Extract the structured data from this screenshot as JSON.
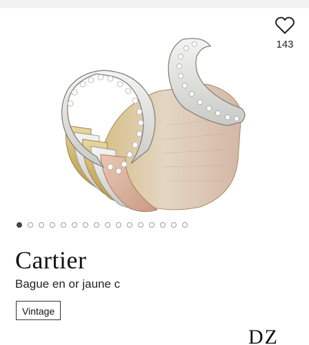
{
  "product": {
    "brand": "Cartier",
    "subtitle": "Bague en or jaune c",
    "badge": "Vintage",
    "favorites_count": "143"
  },
  "gallery": {
    "total_images": 16,
    "active_index": 0
  },
  "seller": {
    "logo_text": "DZ"
  },
  "icons": {
    "favorite": "heart-outline-icon"
  },
  "colors": {
    "text": "#111111",
    "dot_active": "#444444",
    "dot_inactive": "#9a9a9a"
  }
}
